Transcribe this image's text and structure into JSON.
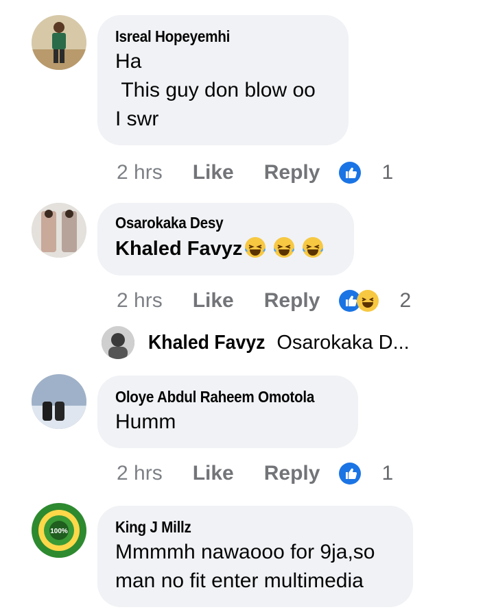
{
  "comments": [
    {
      "author": "Isreal Hopeyemhi",
      "lines": [
        "Ha",
        " This guy don blow oo",
        "I swr"
      ],
      "time": "2 hrs",
      "like_label": "Like",
      "reply_label": "Reply",
      "reactions": [
        "like-icon"
      ],
      "reaction_count": "1"
    },
    {
      "author": "Osarokaka Desy",
      "tag": "Khaled Favyz",
      "emojis": [
        "laughing-crying-emoji",
        "laughing-crying-emoji",
        "laughing-crying-emoji"
      ],
      "time": "2 hrs",
      "like_label": "Like",
      "reply_label": "Reply",
      "reactions": [
        "like-icon",
        "haha-icon"
      ],
      "reaction_count": "2"
    },
    {
      "author": "Oloye Abdul Raheem Omotola",
      "lines": [
        "Humm"
      ],
      "time": "2 hrs",
      "like_label": "Like",
      "reply_label": "Reply",
      "reactions": [
        "like-icon"
      ],
      "reaction_count": "1"
    },
    {
      "author": "King J Millz",
      "lines": [
        "Mmmmh nawaooo for 9ja,so",
        "man no fit enter multimedia"
      ]
    }
  ],
  "reply_preview": {
    "author": "Khaled Favyz",
    "text": "Osarokaka D..."
  },
  "avatar_badge": "100%",
  "colors": {
    "bubble": "#f0f2f5",
    "like_blue": "#1b74e4",
    "haha_yellow": "#f7c842",
    "meta_gray": "#65676b"
  }
}
